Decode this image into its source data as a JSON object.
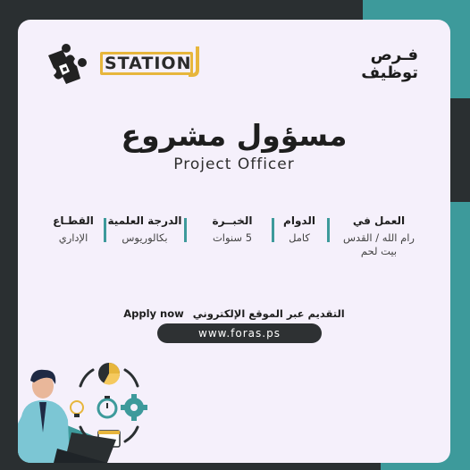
{
  "brand": {
    "station_text": "STATION",
    "foras_line1": "فـرص",
    "foras_line2": "توظيف"
  },
  "job": {
    "title_ar": "مسؤول مشروع",
    "title_en": "Project Officer"
  },
  "details": [
    {
      "label": "العمل في",
      "value": "رام الله / القدس",
      "value2": "بيت لحم"
    },
    {
      "label": "الدوام",
      "value": "كامل",
      "value2": ""
    },
    {
      "label": "الخبــرة",
      "value": "5 سنوات",
      "value2": ""
    },
    {
      "label": "الدرجة العلمية",
      "value": "بكالوريوس",
      "value2": ""
    },
    {
      "label": "القطـاع",
      "value": "الإداري",
      "value2": ""
    }
  ],
  "apply": {
    "text_ar": "التقديم عبر الموقع الإلكتروني",
    "text_en": "Apply now",
    "url": "www.foras.ps"
  },
  "colors": {
    "teal": "#3d9a9b",
    "dark": "#2a2f31",
    "card": "#f5f0fb",
    "gold": "#e7b63c"
  }
}
